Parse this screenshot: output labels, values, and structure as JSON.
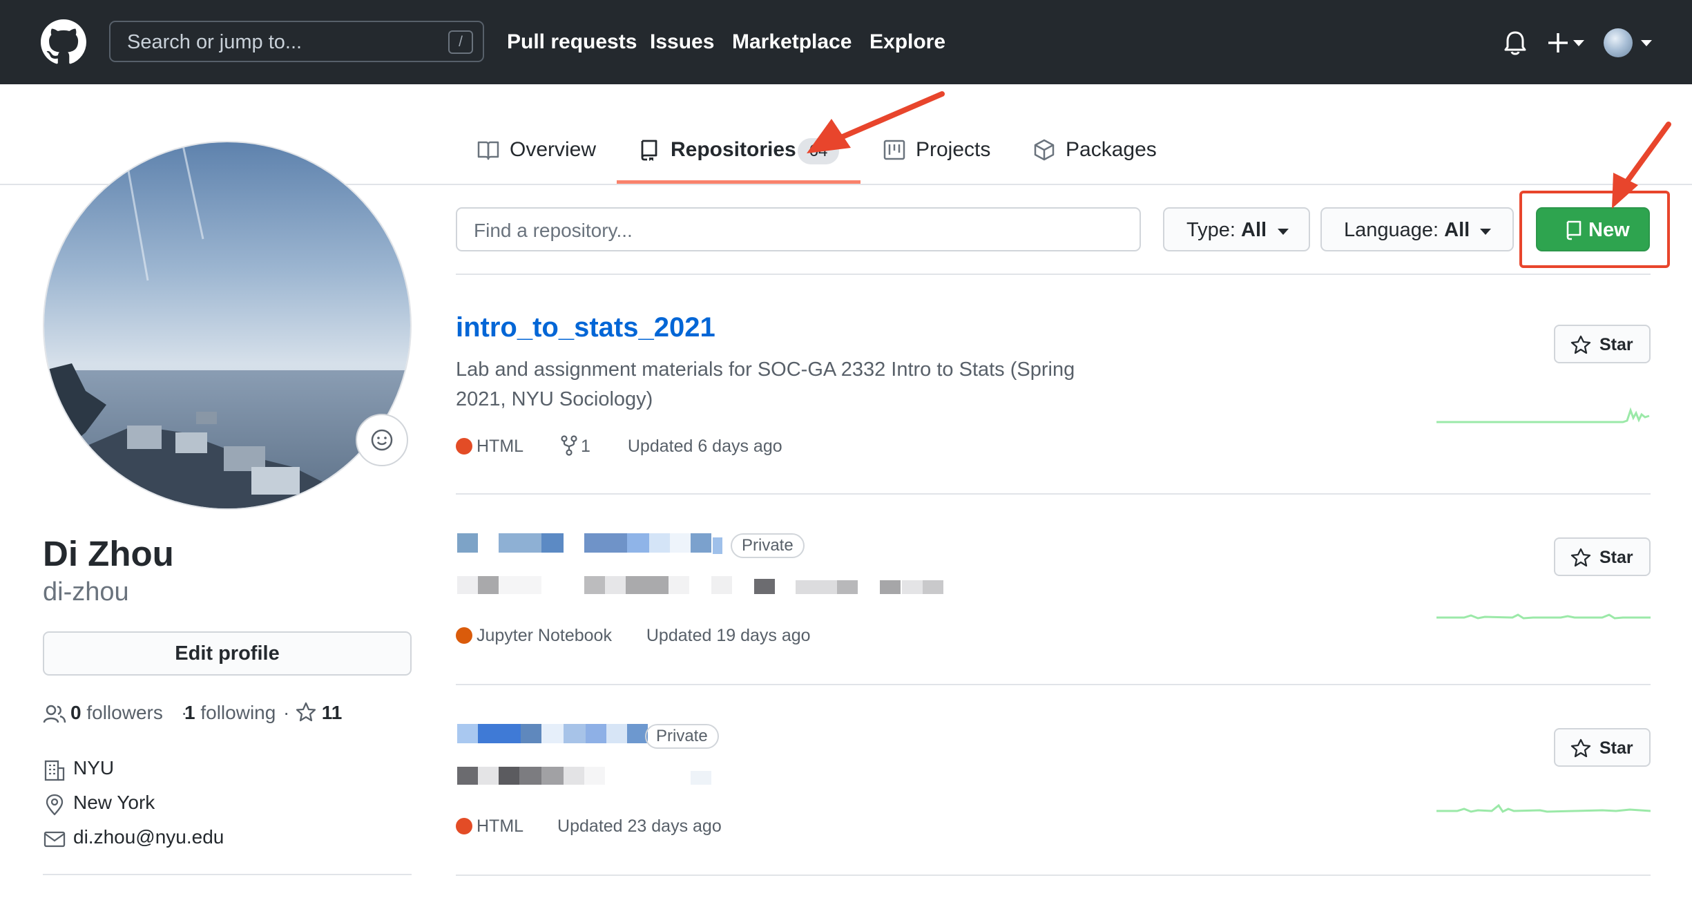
{
  "header": {
    "search_placeholder": "Search or jump to...",
    "search_shortcut": "/",
    "nav": [
      "Pull requests",
      "Issues",
      "Marketplace",
      "Explore"
    ]
  },
  "tabs": [
    {
      "label": "Overview",
      "icon": "book-icon"
    },
    {
      "label": "Repositories",
      "icon": "repo-icon",
      "active": true,
      "count": "64"
    },
    {
      "label": "Projects",
      "icon": "project-icon"
    },
    {
      "label": "Packages",
      "icon": "package-icon"
    }
  ],
  "profile": {
    "name": "Di Zhou",
    "login": "di-zhou",
    "edit_label": "Edit profile",
    "followers_count": "0",
    "followers_label": "followers",
    "following_count": "1",
    "following_label": "following",
    "stars_count": "11",
    "organization": "NYU",
    "location": "New York",
    "email": "di.zhou@nyu.edu"
  },
  "toolbar": {
    "find_placeholder": "Find a repository...",
    "type_label": "Type: ",
    "type_value": "All",
    "language_label": "Language: ",
    "language_value": "All",
    "new_label": "New"
  },
  "repos": [
    {
      "name": "intro_to_stats_2021",
      "description": "Lab and assignment materials for SOC-GA 2332 Intro to Stats (Spring 2021, NYU Sociology)",
      "language": "HTML",
      "language_color": "#e34c26",
      "forks": "1",
      "updated": "Updated 6 days ago",
      "star_label": "Star"
    },
    {
      "visibility": "Private",
      "language": "Jupyter Notebook",
      "language_color": "#DA5B0B",
      "updated": "Updated 19 days ago",
      "star_label": "Star"
    },
    {
      "visibility": "Private",
      "language": "HTML",
      "language_color": "#e34c26",
      "updated": "Updated 23 days ago",
      "star_label": "Star"
    }
  ],
  "colors": {
    "header_bg": "#24292e",
    "link": "#0366d6",
    "new_button": "#2ea44f",
    "tab_underline": "#f9826c",
    "annotation": "#e8452c",
    "sparkline": "#9be9a8"
  }
}
